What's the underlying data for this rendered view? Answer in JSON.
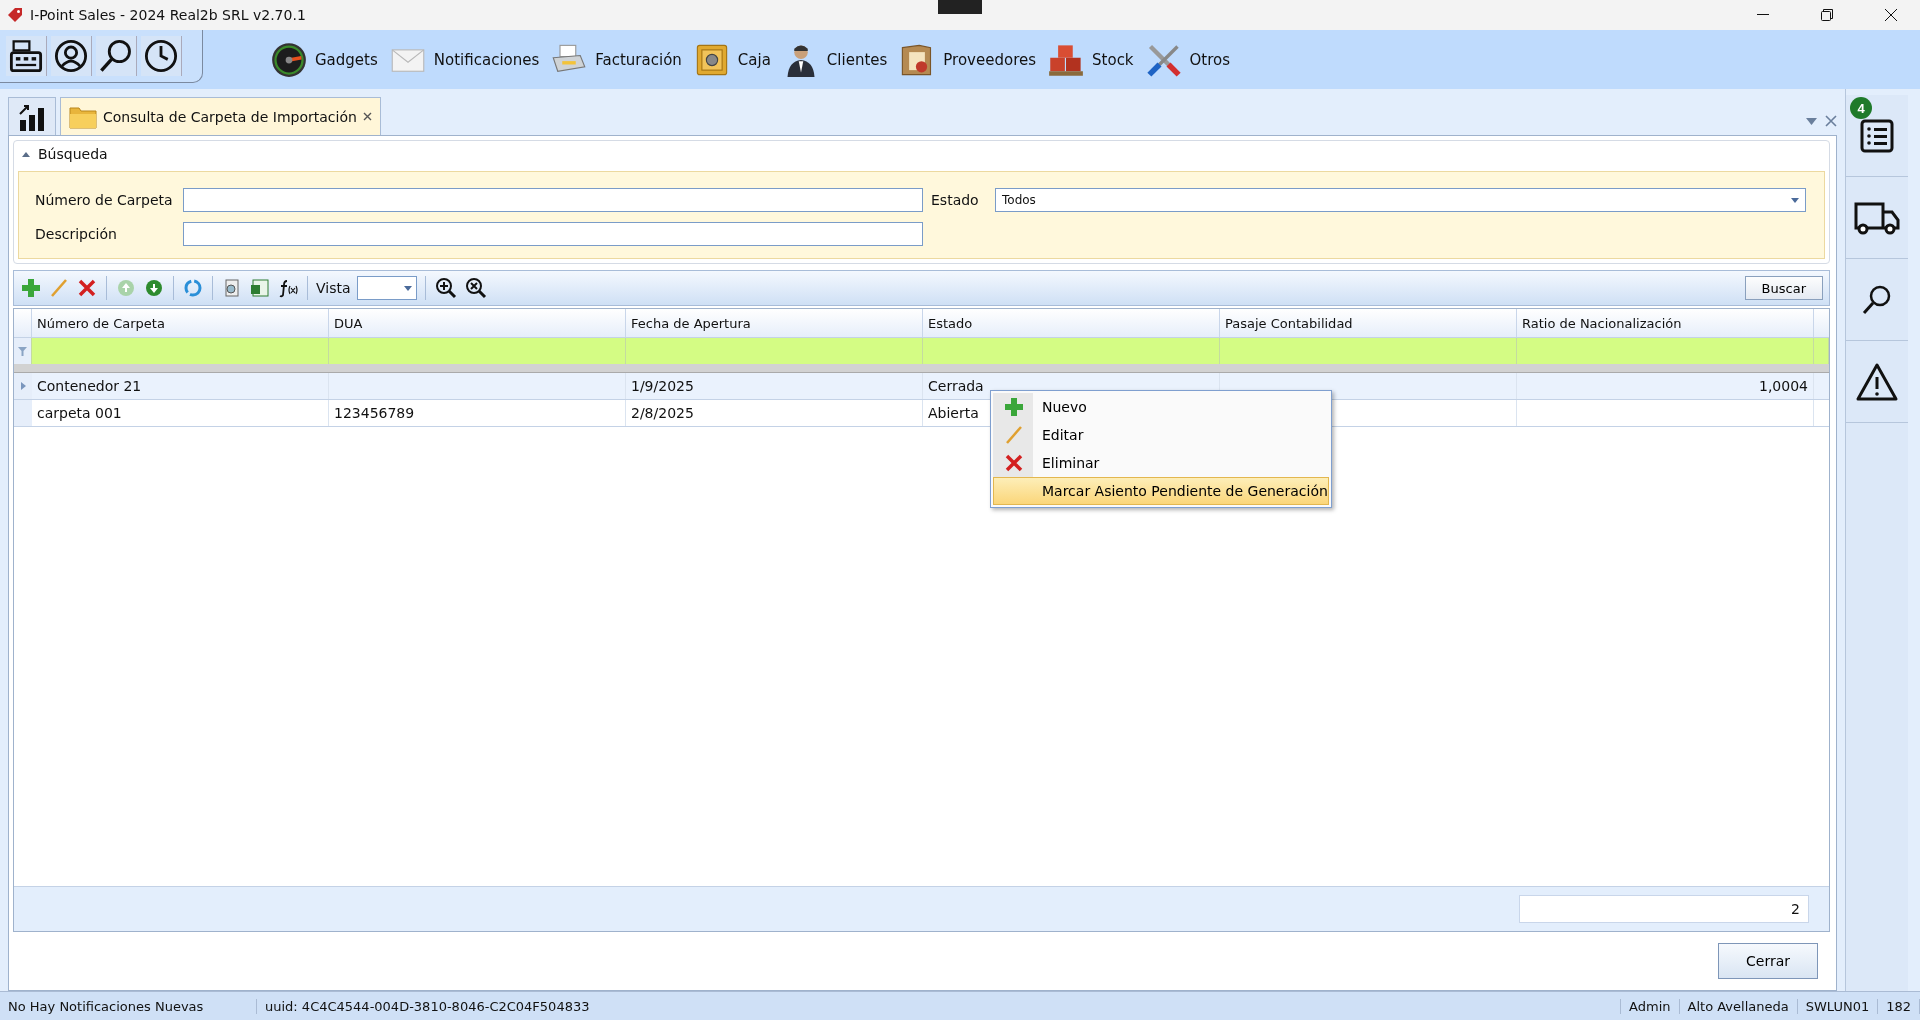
{
  "window": {
    "title": "I-Point Sales  - 2024 Real2b SRL v2.70.1"
  },
  "quick_access": [
    {
      "kind": "register"
    },
    {
      "kind": "user"
    },
    {
      "kind": "search"
    },
    {
      "kind": "clock"
    }
  ],
  "ribbon": [
    {
      "label": "Gadgets",
      "kind": "gauge"
    },
    {
      "label": "Notificaciones",
      "kind": "envelope"
    },
    {
      "label": "Facturación",
      "kind": "printer"
    },
    {
      "label": "Caja",
      "kind": "safe"
    },
    {
      "label": "Clientes",
      "kind": "person"
    },
    {
      "label": "Proveedores",
      "kind": "folder-person"
    },
    {
      "label": "Stock",
      "kind": "boxes"
    },
    {
      "label": "Otros",
      "kind": "tools"
    }
  ],
  "tabs": [
    {
      "kind": "chart",
      "selected": false
    },
    {
      "kind": "document",
      "label": "Consulta de Carpeta de Importación",
      "selected": true
    }
  ],
  "search": {
    "title": "Búsqueda",
    "expanded": true,
    "fields": [
      {
        "label": "Número de Carpeta"
      },
      {
        "label": "Estado",
        "value": "Todos",
        "kind": "dropdown"
      },
      {
        "label": "Descripción"
      }
    ]
  },
  "toolbar": {
    "vista_label": "Vista",
    "search_button": "Buscar"
  },
  "table": {
    "columns": [
      "Número de Carpeta",
      "DUA",
      "Fecha de Apertura",
      "Estado",
      "Pasaje Contabilidad",
      "Ratio de Nacionalización"
    ],
    "rows": [
      {
        "selected": true,
        "cells": [
          "Contenedor 21",
          "",
          "1/9/2025",
          "Cerrada",
          "",
          "1,0004"
        ]
      },
      {
        "selected": false,
        "cells": [
          "carpeta 001",
          "123456789",
          "2/8/2025",
          "Abierta",
          "",
          ""
        ]
      }
    ],
    "count": "2"
  },
  "context_menu": [
    {
      "label": "Nuevo",
      "kind": "add",
      "selected": false
    },
    {
      "label": "Editar",
      "kind": "edit",
      "selected": false
    },
    {
      "label": "Eliminar",
      "kind": "delete",
      "selected": false
    },
    {
      "label": "Marcar Asiento Pendiente de Generación",
      "selected": true
    }
  ],
  "close_button": "Cerrar",
  "sidebar": [
    {
      "kind": "list",
      "badge": "4"
    },
    {
      "kind": "truck"
    },
    {
      "kind": "search"
    },
    {
      "kind": "warning"
    }
  ],
  "status_bar": [
    "No Hay Notificaciones Nuevas",
    "uuid: 4C4C4544-004D-3810-8046-C2C04F504833",
    "Admin",
    "Alto Avellaneda",
    "SWLUN01",
    "182"
  ]
}
